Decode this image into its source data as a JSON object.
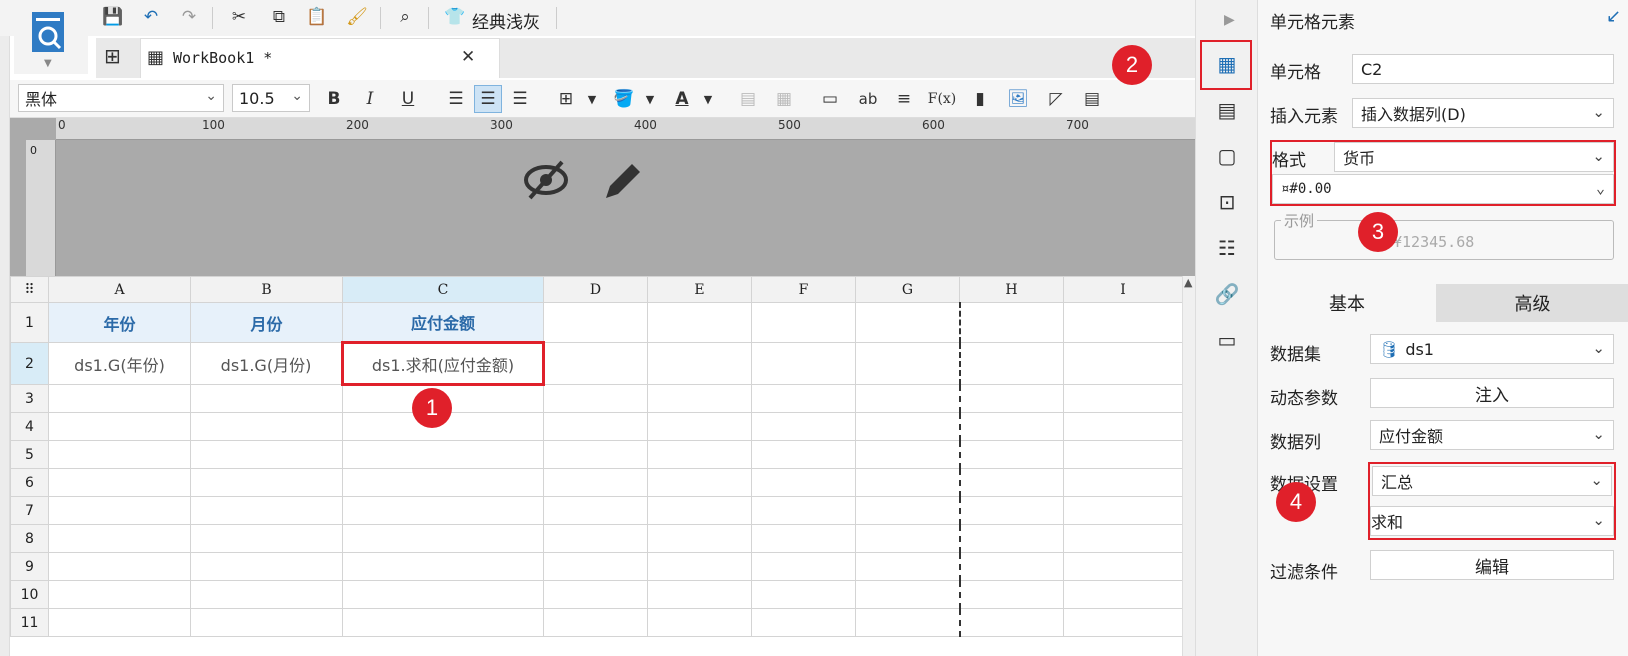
{
  "toolbar": {
    "theme_label": "经典浅灰",
    "icons": [
      "save-icon",
      "undo-icon",
      "redo-icon",
      "cut-icon",
      "copy-icon",
      "paste-icon",
      "format-painter-icon",
      "preview-icon",
      "theme-icon"
    ]
  },
  "tab": {
    "label": "WorkBook1 *",
    "close": "✕"
  },
  "format_bar": {
    "font": "黑体",
    "size": "10.5",
    "bold": "B",
    "italic": "I",
    "underline": "U",
    "ab": "ab",
    "fx": "F(x)",
    "font_color_letter": "A"
  },
  "ruler": {
    "ticks": [
      "0",
      "100",
      "200",
      "300",
      "400",
      "500",
      "600",
      "700"
    ],
    "v_tick": "0"
  },
  "sheet": {
    "columns": [
      "A",
      "B",
      "C",
      "D",
      "E",
      "F",
      "G",
      "H",
      "I"
    ],
    "rows": [
      "1",
      "2",
      "3",
      "4",
      "5",
      "6",
      "7",
      "8",
      "9",
      "10",
      "11"
    ],
    "row1": [
      "年份",
      "月份",
      "应付金额"
    ],
    "row2": [
      "ds1.G(年份)",
      "ds1.G(月份)",
      "ds1.求和(应付金额)"
    ]
  },
  "panel": {
    "title": "单元格元素",
    "cell_label": "单元格",
    "cell_value": "C2",
    "insert_label": "插入元素",
    "insert_value": "插入数据列(D)",
    "format_label": "格式",
    "format_value": "货币",
    "format_pattern": "¤#0.00",
    "example_label": "示例",
    "example_value": "¥12345.68",
    "tab_basic": "基本",
    "tab_advanced": "高级",
    "dataset_label": "数据集",
    "dataset_value": "ds1",
    "dynamic_label": "动态参数",
    "dynamic_button": "注入",
    "column_label": "数据列",
    "column_value": "应付金额",
    "setting_label": "数据设置",
    "setting_value": "汇总",
    "setting_func": "求和",
    "filter_label": "过滤条件",
    "filter_button": "编辑"
  },
  "badges": [
    "1",
    "2",
    "3",
    "4"
  ],
  "colors": {
    "accent": "#1f6fb5",
    "highlight_red": "#e0202a",
    "title_text": "#2b6aa8"
  }
}
